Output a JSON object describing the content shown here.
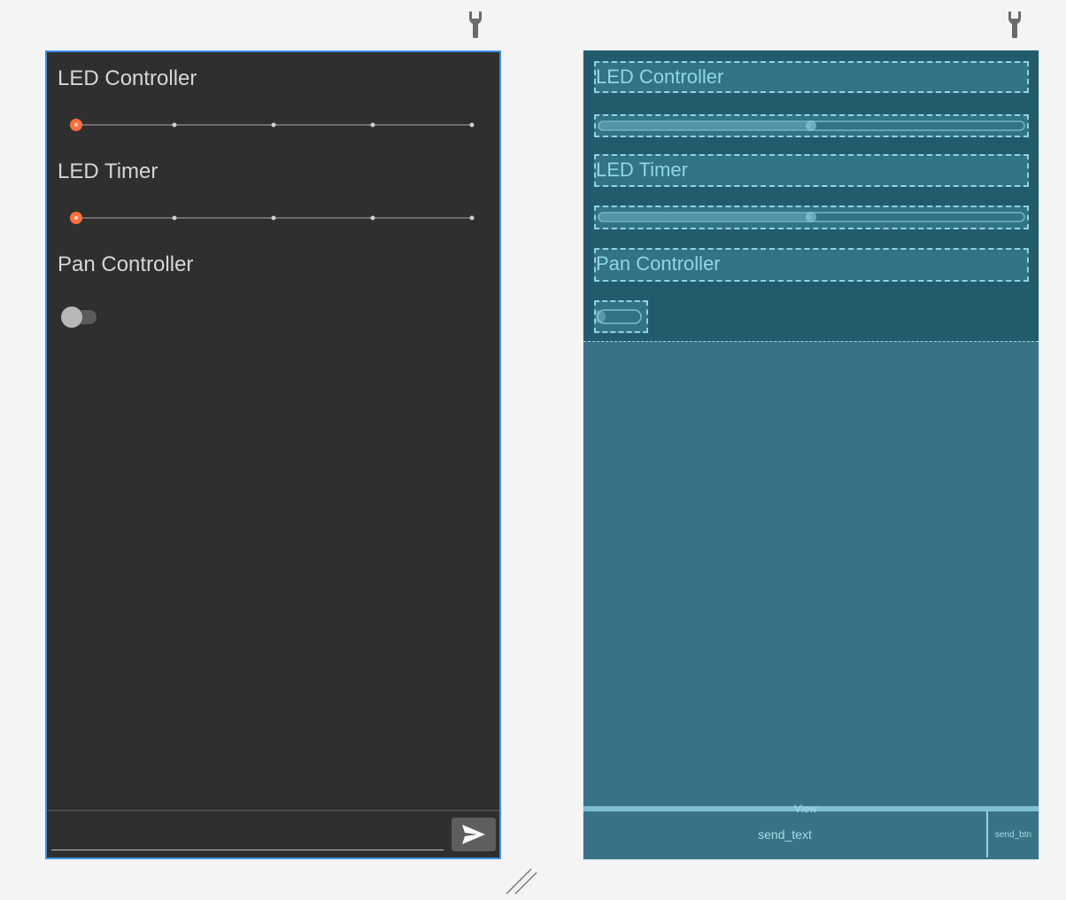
{
  "design": {
    "led_controller_label": "LED Controller",
    "led_timer_label": "LED Timer",
    "pan_controller_label": "Pan Controller",
    "led_controller_slider": {
      "value": 0,
      "steps": 4
    },
    "led_timer_slider": {
      "value": 0,
      "steps": 4
    },
    "pan_switch": {
      "checked": false
    },
    "send_text": {
      "value": "",
      "placeholder": ""
    },
    "send_button_icon": "send-icon"
  },
  "blueprint": {
    "led_controller_label": "LED Controller",
    "led_timer_label": "LED Timer",
    "pan_controller_label": "Pan Controller",
    "view_label": "View",
    "send_text_label": "send_text",
    "send_btn_label": "send_btn"
  },
  "colors": {
    "design_background": "#2f2f2f",
    "selection_border": "#3d8fe0",
    "slider_thumb": "#ff6f3c",
    "blueprint_background": "#387385",
    "blueprint_text": "#8ed6e8"
  },
  "icons": {
    "toolbar_icon": "wrench-icon",
    "resize_handle": "resize-handle-icon"
  }
}
